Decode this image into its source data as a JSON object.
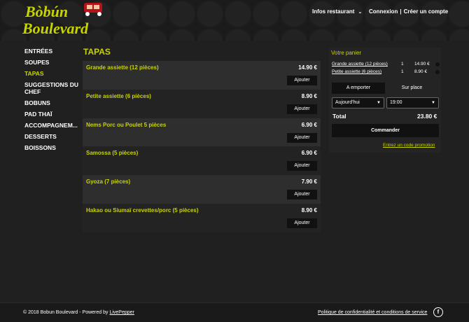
{
  "header": {
    "logo_text": "Bòbún Boulevard",
    "nav_info": "Infos restaurant",
    "login": "Connexion",
    "separator": "|",
    "signup": "Créer un compte"
  },
  "sidebar": {
    "items": [
      {
        "label": "ENTRÉES"
      },
      {
        "label": "SOUPES"
      },
      {
        "label": "TAPAS"
      },
      {
        "label": "SUGGESTIONS DU CHEF"
      },
      {
        "label": "BOBUNS"
      },
      {
        "label": "PAD THAÏ"
      },
      {
        "label": "ACCOMPAGNEM..."
      },
      {
        "label": "DESSERTS"
      },
      {
        "label": "BOISSONS"
      }
    ]
  },
  "section": {
    "title": "TAPAS"
  },
  "products": [
    {
      "name": "Grande assiette (12 pièces)",
      "price": "14.90 €",
      "button": "Ajouter"
    },
    {
      "name": "Petite assiette (6 pièces)",
      "price": "8.90 €",
      "button": "Ajouter"
    },
    {
      "name": "Nems Porc ou Poulet 5 pièces",
      "price": "6.90 €",
      "button": "Ajouter"
    },
    {
      "name": "Samossa (5 pièces)",
      "price": "6.90 €",
      "button": "Ajouter"
    },
    {
      "name": "Gyoza (7 pièces)",
      "price": "7.90 €",
      "button": "Ajouter"
    },
    {
      "name": "Hakao ou Siumaï crevettes/porc (5 pièces)",
      "price": "8.90 €",
      "button": "Ajouter"
    }
  ],
  "cart": {
    "title": "Votre panier",
    "items": [
      {
        "name": "Grande assiette (12 pièces)",
        "qty": "1",
        "price": "14.90 €"
      },
      {
        "name": "Petite assiette (6 pièces)",
        "qty": "1",
        "price": "8.90 €"
      }
    ],
    "mode_takeaway": "A emporter",
    "mode_dinein": "Sur place",
    "day": "Aujourd'hui",
    "time": "19:00",
    "total_label": "Total",
    "total_value": "23.80 €",
    "order_button": "Commander",
    "promo_link": "Entrez un code promotion"
  },
  "footer": {
    "copyright": "© 2018 Bobun Boulevard - Powered by ",
    "powered_link": "LivePepper",
    "privacy": "Politique de confidentialité et conditions de service",
    "social": "f"
  },
  "colors": {
    "accent": "#c8d400",
    "background": "#202020",
    "panel": "#2e2e2e",
    "button": "#111111"
  }
}
